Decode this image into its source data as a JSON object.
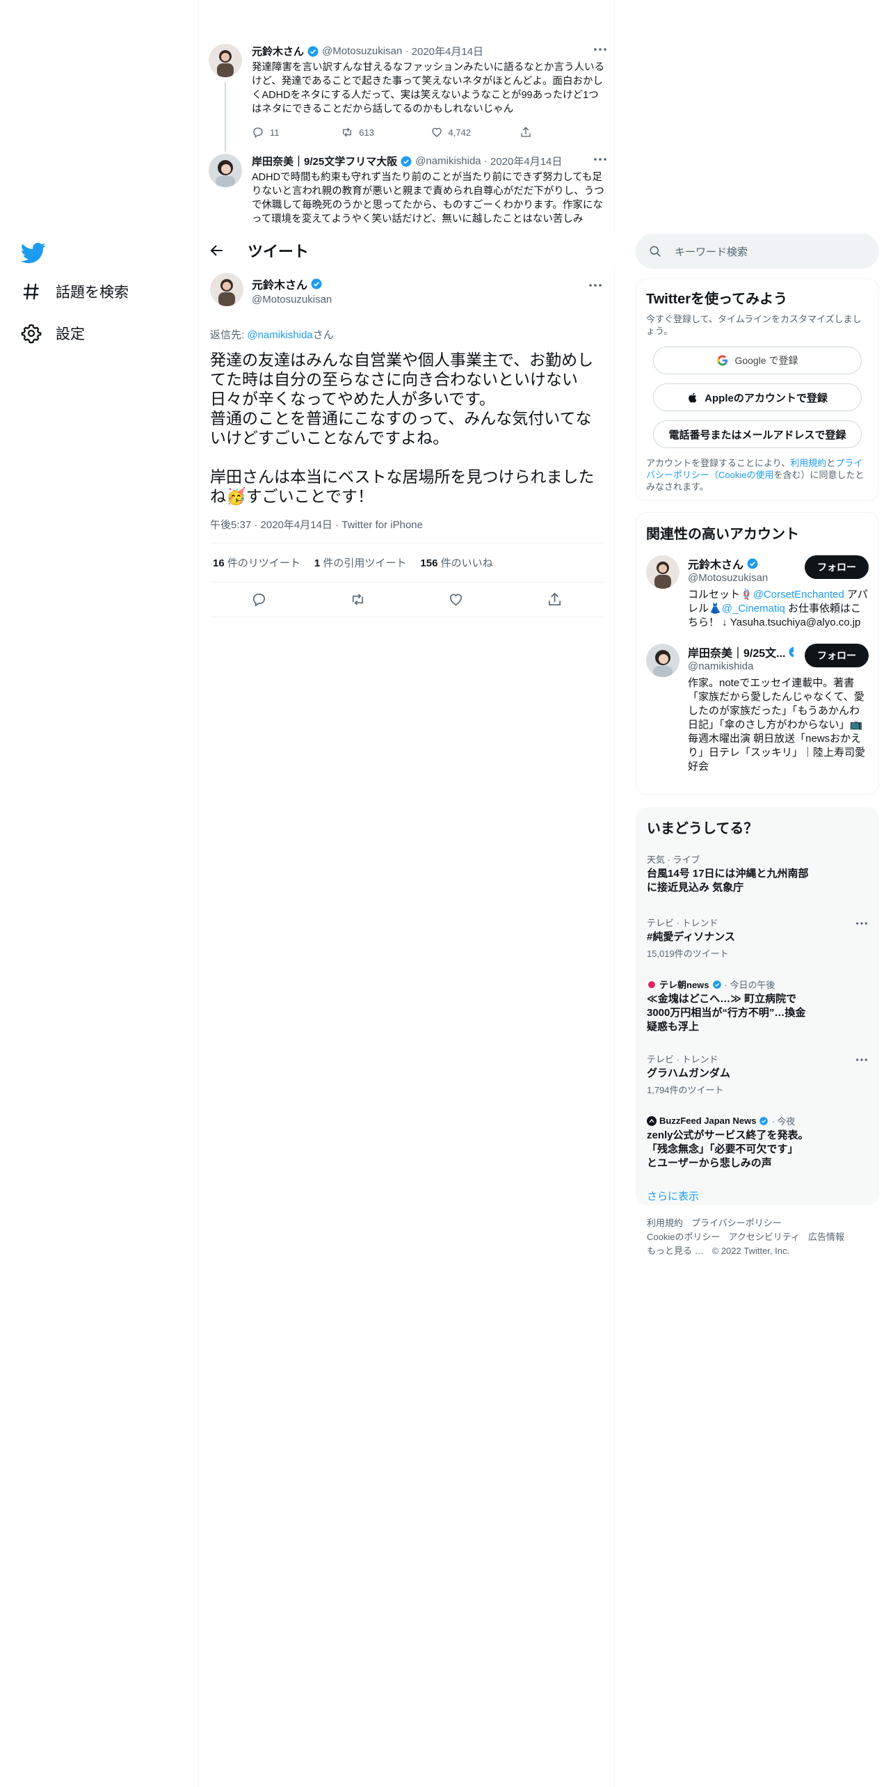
{
  "nav": {
    "explore_label": "話題を検索",
    "settings_label": "設定"
  },
  "context_tweets": [
    {
      "name": "元鈴木さん",
      "handle": "@Motosuzukisan",
      "date": "2020年4月14日",
      "text": "発達障害を言い訳すんな甘えるなファッションみたいに語るなとか言う人いるけど、発達であることで起きた事って笑えないネタがほとんどよ。面白おかしくADHDをネタにする人だって、実は笑えないようなことが99あったけど1つはネタにできることだから話してるのかもしれないじゃん",
      "replies": "11",
      "retweets": "613",
      "likes": "4,742"
    },
    {
      "name": "岸田奈美｜9/25文学フリマ大阪",
      "handle": "@namikishida",
      "date": "2020年4月14日",
      "text": "ADHDで時間も約束も守れず当たり前のことが当たり前にできず努力しても足りないと言われ親の教育が悪いと親まで責められ自尊心がだだ下がりし、うつで休職して毎晩死のうかと思ってたから、ものすごーくわかります。作家になって環境を変えてようやく笑い話だけど、無いに越したことはない苦しみ"
    }
  ],
  "header": {
    "title": "ツイート"
  },
  "main_tweet": {
    "name": "元鈴木さん",
    "handle": "@Motosuzukisan",
    "reply_prefix": "返信先: ",
    "reply_to": "@namikishida",
    "reply_suffix": "さん",
    "text_1": "発達の友達はみんな自営業や個人事業主で、お勤めしてた時は自分の至らなさに向き合わないといけない日々が辛くなってやめた人が多いです。\n普通のことを普通にこなすのって、みんな気付いてないけどすごいことなんですよね。\n\n岸田さんは本当にベストな居場所を見つけられましたね",
    "emoji": "🥳",
    "text_2": "すごいことです！",
    "meta": "午後5:37 · 2020年4月14日 · Twitter for iPhone",
    "retweet_count": "16",
    "retweet_label": "件のリツイート",
    "quote_count": "1",
    "quote_label": "件の引用ツイート",
    "like_count": "156",
    "like_label": "件のいいね"
  },
  "search": {
    "placeholder": "キーワード検索"
  },
  "signup": {
    "title": "Twitterを使ってみよう",
    "subtitle": "今すぐ登録して、タイムラインをカスタマイズしましょう。",
    "google_label": "Google で登録",
    "apple_label": "Appleのアカウントで登録",
    "phone_label": "電話番号またはメールアドレスで登録",
    "legal_1": "アカウントを登録することにより、",
    "legal_terms": "利用規約",
    "legal_2": "と",
    "legal_privacy": "プライバシーポリシー（Cookieの使用",
    "legal_3": "を含む）に同意したとみなされます。"
  },
  "related": {
    "title": "関連性の高いアカウント",
    "follow_label": "フォロー",
    "accounts": [
      {
        "name": "元鈴木さん",
        "handle": "@Motosuzukisan",
        "bio_1": "コルセット",
        "bio_link_1": "@CorsetEnchanted",
        "bio_2": " アパレル",
        "bio_link_2": "@_Cinematiq",
        "bio_3": " お仕事依頼はこちら！ ↓ Yasuha.tsuchiya@alyo.co.jp"
      },
      {
        "name": "岸田奈美｜9/25文...",
        "handle": "@namikishida",
        "bio": "作家。noteでエッセイ連載中。著書「家族だから愛したんじゃなくて、愛したのが家族だった」「もうあかんわ日記」「傘のさし方がわからない」📺毎週木曜出演 朝日放送「newsおかえり」日テレ「スッキリ」｜陸上寿司愛好会"
      }
    ]
  },
  "trends": {
    "title": "いまどうしてる？",
    "items": [
      {
        "meta": "天気 · ライブ",
        "name": "台風14号 17日には沖縄と九州南部\nに接近見込み 気象庁",
        "count": ""
      },
      {
        "meta": "テレビ · トレンド",
        "name": "#純愛ディソナンス",
        "count": "15,019件のツイート"
      },
      {
        "meta_source": "テレ朝news",
        "meta_time": "· 今日の午後",
        "name": "≪金塊はどこへ…≫ 町立病院で\n3000万円相当が“行方不明”…換金\n疑惑も浮上",
        "count": ""
      },
      {
        "meta": "テレビ · トレンド",
        "name": "グラハムガンダム",
        "count": "1,794件のツイート"
      },
      {
        "meta_source": "BuzzFeed Japan News",
        "meta_time": "· 今夜",
        "name": "zenly公式がサービス終了を発表。\n「残念無念」「必要不可欠です」\nとユーザーから悲しみの声",
        "count": ""
      }
    ],
    "show_more": "さらに表示"
  },
  "footer": {
    "links": [
      "利用規約",
      "プライバシーポリシー",
      "Cookieのポリシー",
      "アクセシビリティ",
      "広告情報",
      "もっと見る …"
    ],
    "copyright": "© 2022 Twitter, Inc."
  },
  "colors": {
    "accent": "#1d9bf0",
    "text": "#0f1419",
    "muted": "#536471",
    "border": "#eff3f4"
  }
}
